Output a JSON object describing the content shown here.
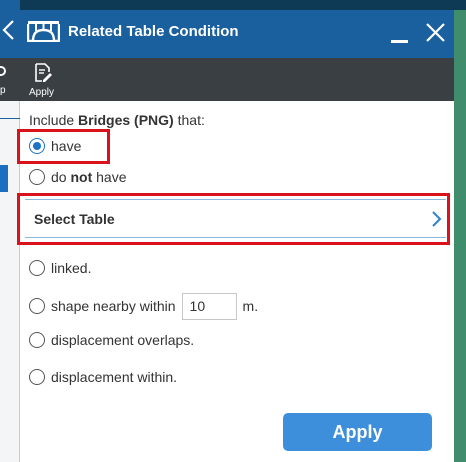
{
  "window": {
    "title": "Related Table Condition",
    "title_icon": "bridge-icon",
    "minimize_icon": "minimize-icon",
    "close_icon": "close-icon"
  },
  "background": {
    "sidebar_fragment_text": "p"
  },
  "toolbar": {
    "apply_label": "Apply",
    "apply_icon": "edit-document-icon"
  },
  "form": {
    "include_prefix": "Include ",
    "layer_name": "Bridges (PNG)",
    "include_suffix": " that:",
    "options_presence": [
      {
        "label": "have",
        "selected": true
      },
      {
        "label_before": "do ",
        "label_bold": "not",
        "label_after": " have",
        "selected": false
      }
    ],
    "select_table_label": "Select Table",
    "select_table_icon": "chevron-right-icon",
    "options_relation": [
      {
        "label": "linked.",
        "selected": false
      },
      {
        "label": "shape nearby within",
        "selected": false,
        "distance_value": "10",
        "unit": "m."
      },
      {
        "label": "displacement overlaps.",
        "selected": false
      },
      {
        "label": "displacement within.",
        "selected": false
      }
    ],
    "apply_button_label": "Apply"
  },
  "colors": {
    "title_bar": "#1a5f9e",
    "toolbar": "#3a3f44",
    "accent": "#1a73c8",
    "apply_button": "#3d8fdb",
    "highlight": "#d9121b"
  }
}
